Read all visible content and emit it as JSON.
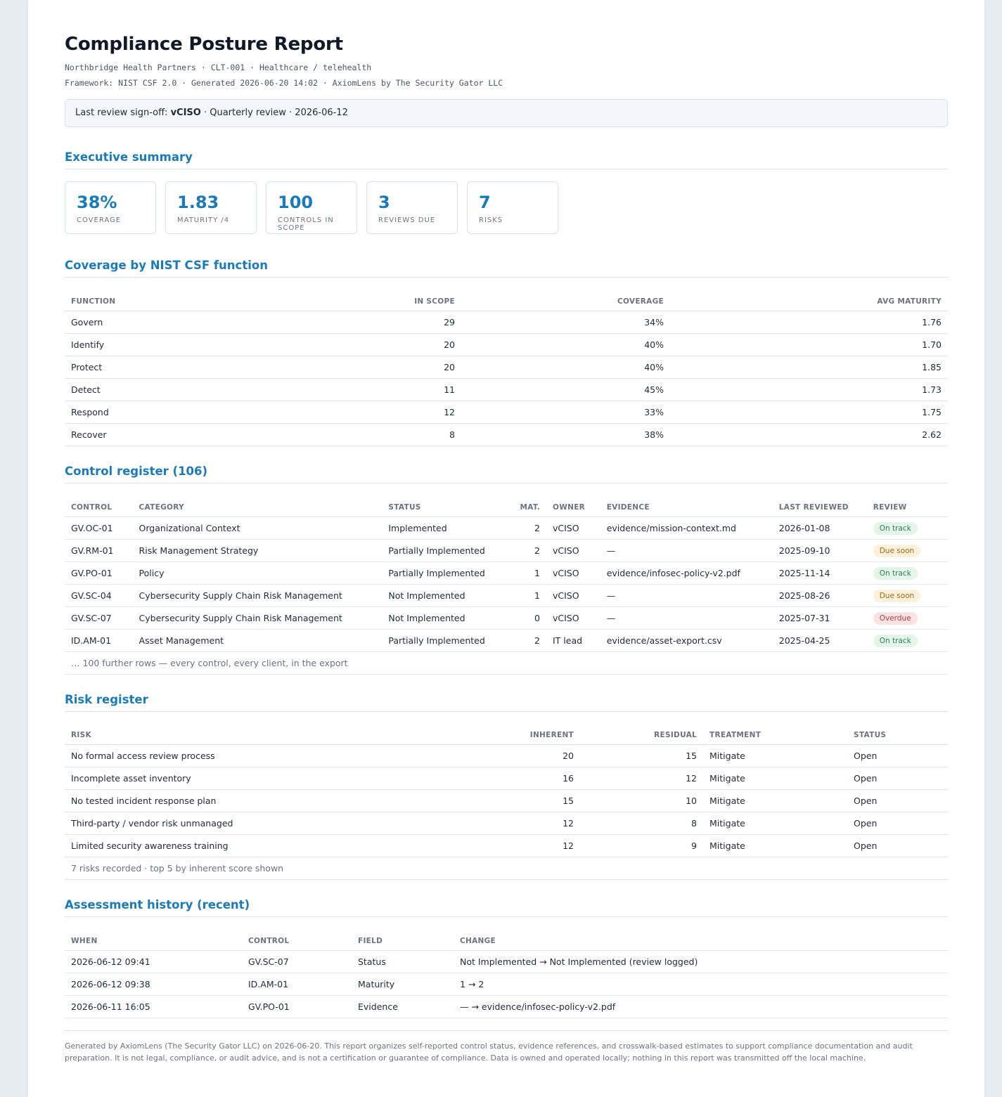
{
  "report": {
    "title": "Compliance Posture Report",
    "meta_line1": "Northbridge Health Partners · CLT-001 · Healthcare / telehealth",
    "meta_line2": "Framework: NIST CSF 2.0 · Generated 2026-06-20 14:02 · AxiomLens by The Security Gator LLC",
    "signoff_prefix": "Last review sign-off:",
    "signoff_role": "vCISO",
    "signoff_suffix": "· Quarterly review · 2026-06-12"
  },
  "executive_summary": {
    "title": "Executive summary",
    "cards": [
      {
        "value": "38%",
        "label": "Coverage"
      },
      {
        "value": "1.83",
        "label": "Maturity /4"
      },
      {
        "value": "100",
        "label": "Controls in scope"
      },
      {
        "value": "3",
        "label": "Reviews due"
      },
      {
        "value": "7",
        "label": "Risks"
      }
    ]
  },
  "coverage": {
    "title": "Coverage by NIST CSF function",
    "headers": [
      "Function",
      "In scope",
      "Coverage",
      "Avg maturity"
    ],
    "rows": [
      [
        "Govern",
        "29",
        "34%",
        "1.76"
      ],
      [
        "Identify",
        "20",
        "40%",
        "1.70"
      ],
      [
        "Protect",
        "20",
        "40%",
        "1.85"
      ],
      [
        "Detect",
        "11",
        "45%",
        "1.73"
      ],
      [
        "Respond",
        "12",
        "33%",
        "1.75"
      ],
      [
        "Recover",
        "8",
        "38%",
        "2.62"
      ]
    ]
  },
  "controls": {
    "title": "Control register (106)",
    "headers": [
      "Control",
      "Category",
      "Status",
      "Mat.",
      "Owner",
      "Evidence",
      "Last reviewed",
      "Review"
    ],
    "rows": [
      [
        "GV.OC-01",
        "Organizational Context",
        "Implemented",
        "2",
        "vCISO",
        "evidence/mission-context.md",
        "2026-01-08",
        "On track"
      ],
      [
        "GV.RM-01",
        "Risk Management Strategy",
        "Partially Implemented",
        "2",
        "vCISO",
        "—",
        "2025-09-10",
        "Due soon"
      ],
      [
        "GV.PO-01",
        "Policy",
        "Partially Implemented",
        "1",
        "vCISO",
        "evidence/infosec-policy-v2.pdf",
        "2025-11-14",
        "On track"
      ],
      [
        "GV.SC-04",
        "Cybersecurity Supply Chain Risk Management",
        "Not Implemented",
        "1",
        "vCISO",
        "—",
        "2025-08-26",
        "Due soon"
      ],
      [
        "GV.SC-07",
        "Cybersecurity Supply Chain Risk Management",
        "Not Implemented",
        "0",
        "vCISO",
        "—",
        "2025-07-31",
        "Overdue"
      ],
      [
        "ID.AM-01",
        "Asset Management",
        "Partially Implemented",
        "2",
        "IT lead",
        "evidence/asset-export.csv",
        "2025-04-25",
        "On track"
      ]
    ],
    "review_colors": {
      "On track": "ok",
      "Due soon": "soon",
      "Overdue": "over"
    },
    "note": "… 100 further rows — every control, every client, in the export"
  },
  "risks": {
    "title": "Risk register",
    "headers": [
      "Risk",
      "Inherent",
      "Residual",
      "Treatment",
      "Status"
    ],
    "rows": [
      [
        "No formal access review process",
        "20",
        "15",
        "Mitigate",
        "Open"
      ],
      [
        "Incomplete asset inventory",
        "16",
        "12",
        "Mitigate",
        "Open"
      ],
      [
        "No tested incident response plan",
        "15",
        "10",
        "Mitigate",
        "Open"
      ],
      [
        "Third-party / vendor risk unmanaged",
        "12",
        "8",
        "Mitigate",
        "Open"
      ],
      [
        "Limited security awareness training",
        "12",
        "9",
        "Mitigate",
        "Open"
      ]
    ],
    "note": "7 risks recorded · top 5 by inherent score shown"
  },
  "history": {
    "title": "Assessment history (recent)",
    "headers": [
      "When",
      "Control",
      "Field",
      "Change"
    ],
    "rows": [
      [
        "2026-06-12 09:41",
        "GV.SC-07",
        "Status",
        "Not Implemented → Not Implemented (review logged)"
      ],
      [
        "2026-06-12 09:38",
        "ID.AM-01",
        "Maturity",
        "1 → 2"
      ],
      [
        "2026-06-11 16:05",
        "GV.PO-01",
        "Evidence",
        "— → evidence/infosec-policy-v2.pdf"
      ]
    ]
  },
  "footer": "Generated by AxiomLens (The Security Gator LLC) on 2026-06-20. This report organizes self-reported control status, evidence references, and crosswalk-based estimates to support compliance documentation and audit preparation. It is not legal, compliance, or audit advice, and is not a certification or guarantee of compliance. Data is owned and operated locally; nothing in this report was transmitted off the local machine.",
  "colors": {
    "accent": "#1a7bb8",
    "on_track": "#2e7d4f",
    "due_soon": "#9a6a16",
    "overdue": "#b43a3a"
  }
}
